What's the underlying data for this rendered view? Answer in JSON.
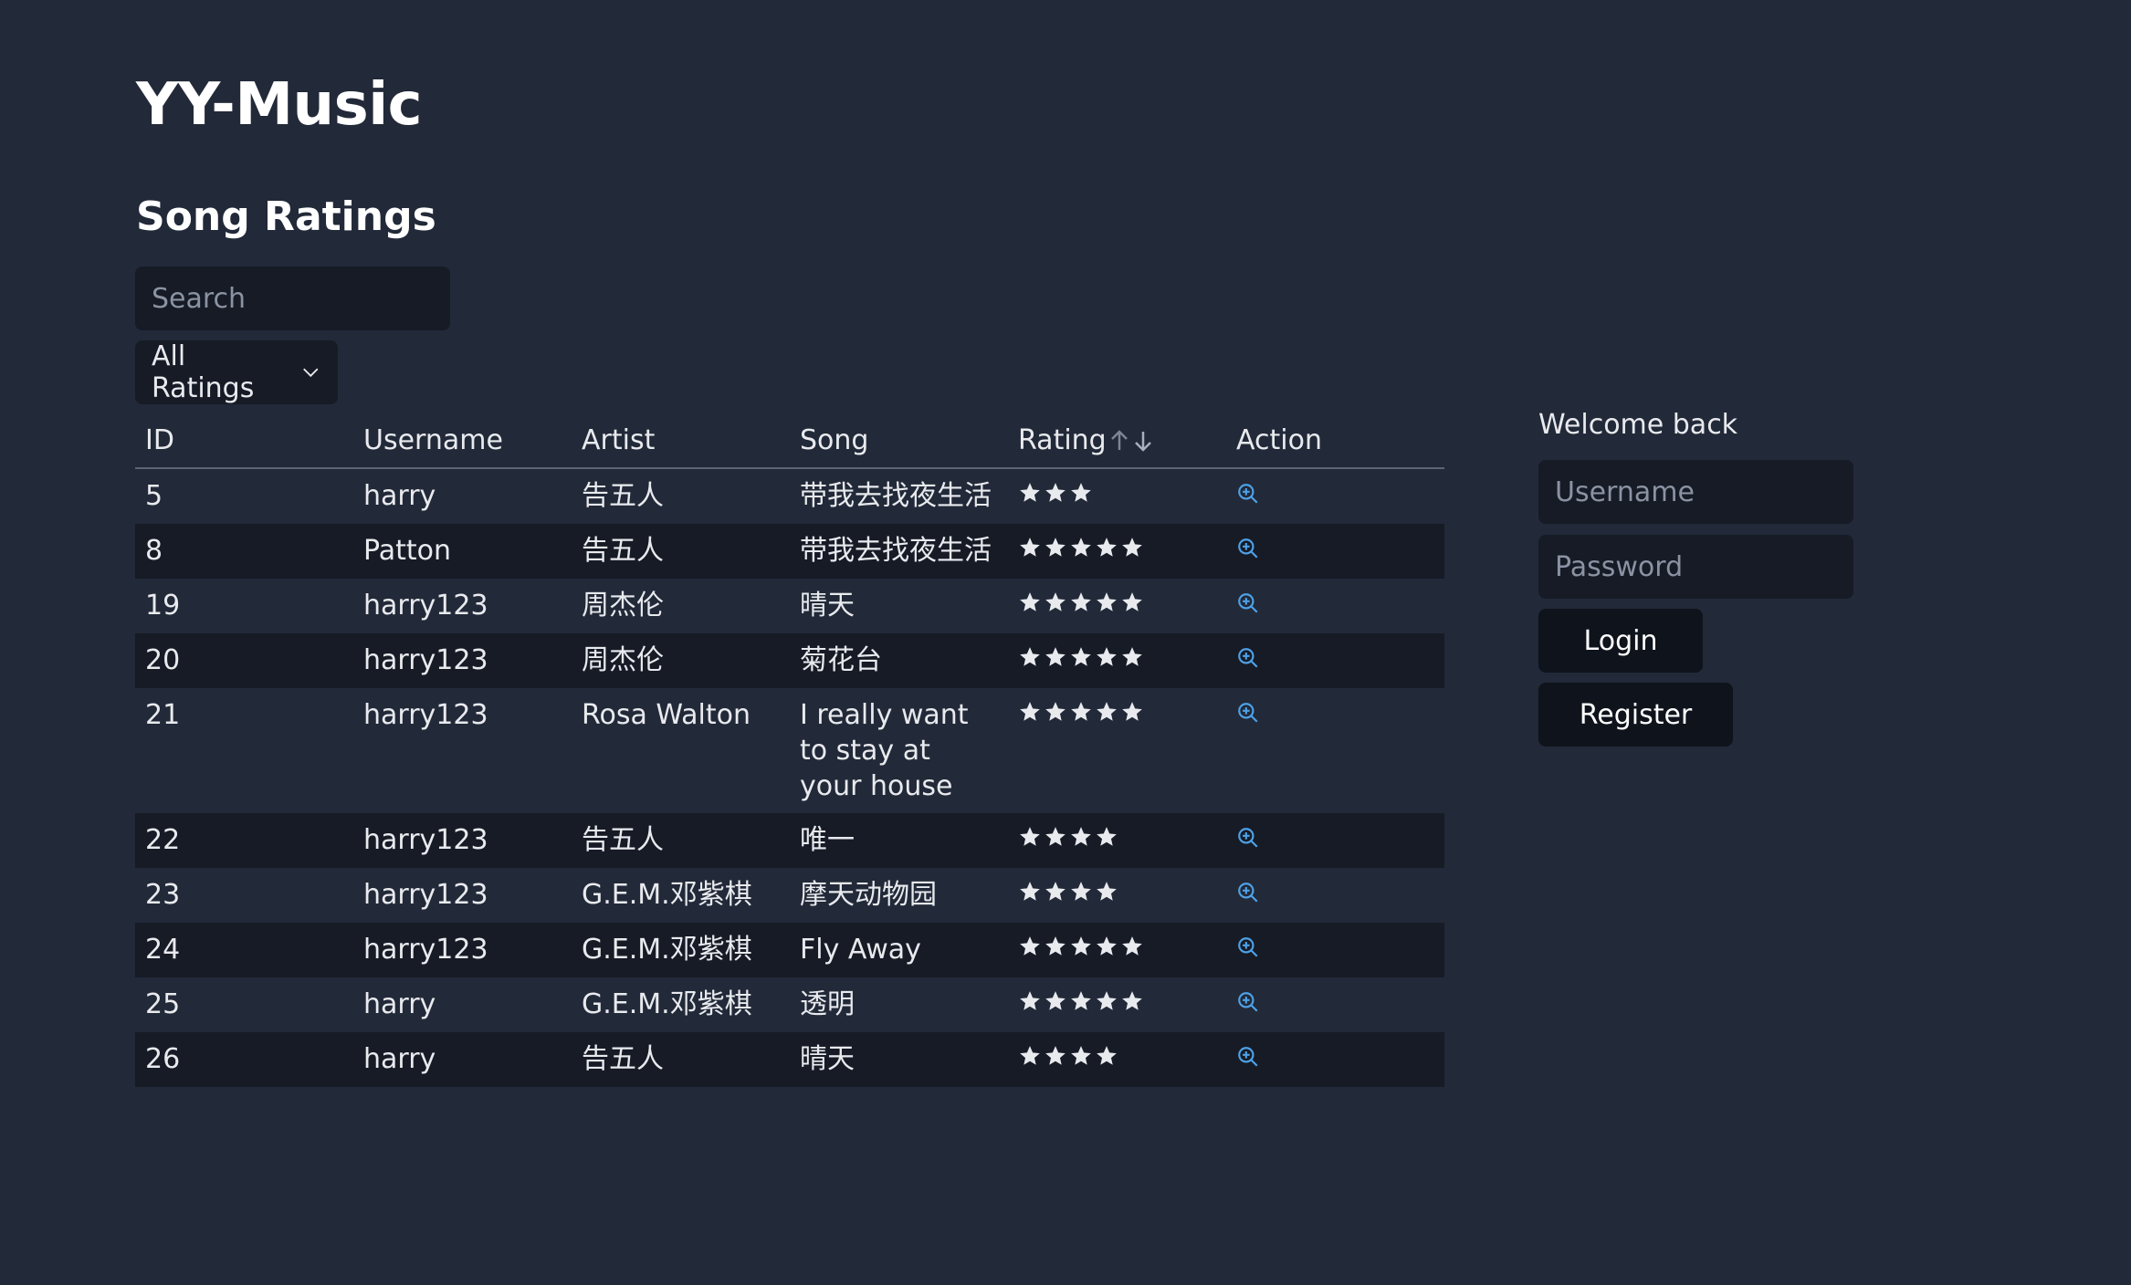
{
  "app": {
    "title": "YY-Music"
  },
  "section": {
    "title": "Song Ratings"
  },
  "search": {
    "placeholder": "Search"
  },
  "filter": {
    "selected": "All Ratings"
  },
  "table": {
    "headers": [
      "ID",
      "Username",
      "Artist",
      "Song",
      "Rating",
      "Action"
    ],
    "rows": [
      {
        "id": "5",
        "username": "harry",
        "artist": "告五人",
        "song": "带我去找夜生活",
        "rating": 3
      },
      {
        "id": "8",
        "username": "Patton",
        "artist": "告五人",
        "song": "带我去找夜生活",
        "rating": 5
      },
      {
        "id": "19",
        "username": "harry123",
        "artist": "周杰伦",
        "song": "晴天",
        "rating": 5
      },
      {
        "id": "20",
        "username": "harry123",
        "artist": "周杰伦",
        "song": "菊花台",
        "rating": 5
      },
      {
        "id": "21",
        "username": "harry123",
        "artist": "Rosa Walton",
        "song": "I really want to stay at your house",
        "rating": 5
      },
      {
        "id": "22",
        "username": "harry123",
        "artist": "告五人",
        "song": "唯一",
        "rating": 4
      },
      {
        "id": "23",
        "username": "harry123",
        "artist": "G.E.M.邓紫棋",
        "song": "摩天动物园",
        "rating": 4
      },
      {
        "id": "24",
        "username": "harry123",
        "artist": "G.E.M.邓紫棋",
        "song": "Fly Away",
        "rating": 5
      },
      {
        "id": "25",
        "username": "harry",
        "artist": "G.E.M.邓紫棋",
        "song": "透明",
        "rating": 5
      },
      {
        "id": "26",
        "username": "harry",
        "artist": "告五人",
        "song": "晴天",
        "rating": 4
      }
    ]
  },
  "login": {
    "welcome": "Welcome back",
    "username_placeholder": "Username",
    "password_placeholder": "Password",
    "login_label": "Login",
    "register_label": "Register"
  },
  "icons": {
    "action": "zoom-in-icon",
    "rating": "star-icon",
    "sort": "sort-arrows-icon"
  },
  "colors": {
    "background": "#222938",
    "field": "#161b26",
    "button": "#0f131b",
    "accent": "#4ea1e6",
    "star": "#e8eaee"
  }
}
